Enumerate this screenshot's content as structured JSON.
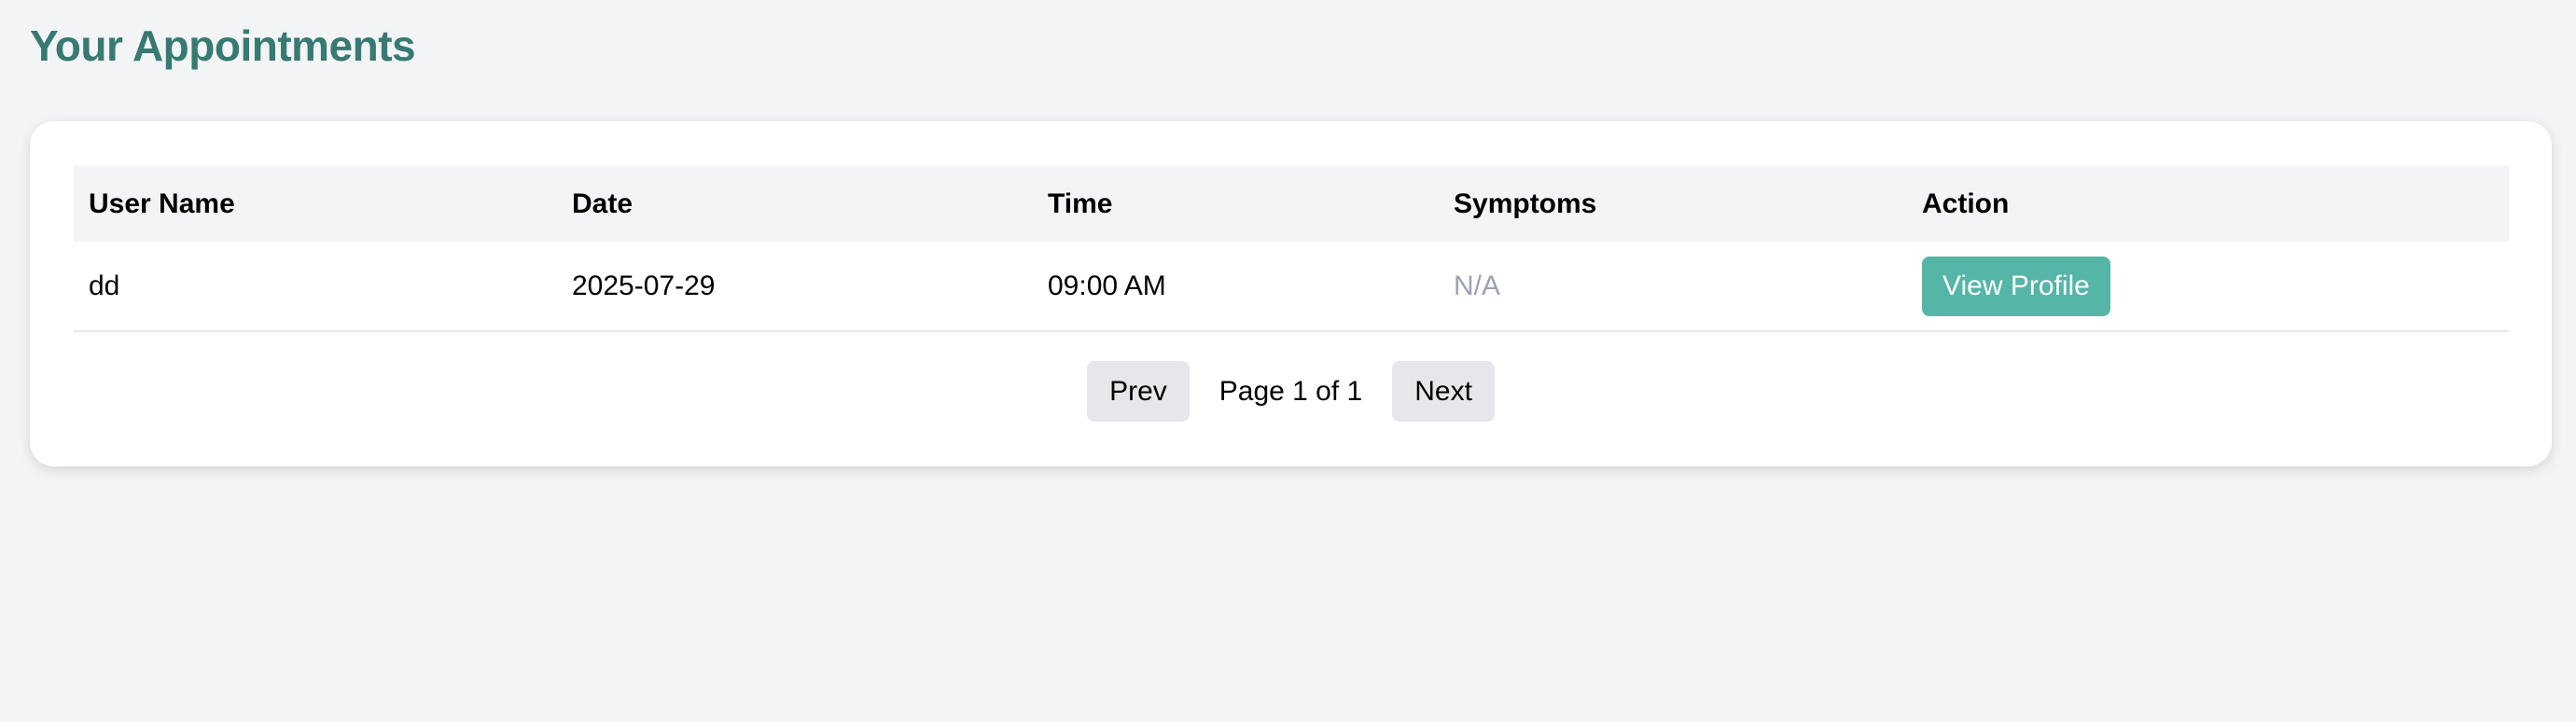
{
  "page": {
    "title": "Your Appointments"
  },
  "table": {
    "columns": [
      "User Name",
      "Date",
      "Time",
      "Symptoms",
      "Action"
    ],
    "rows": [
      {
        "user_name": "dd",
        "date": "2025-07-29",
        "time": "09:00 AM",
        "symptoms": "N/A",
        "action": "View Profile"
      }
    ]
  },
  "pagination": {
    "prev": "Prev",
    "status": "Page 1 of 1",
    "next": "Next"
  },
  "colors": {
    "title": "#367a72",
    "action_button": "#55b5a6",
    "muted": "#9ca3af"
  }
}
